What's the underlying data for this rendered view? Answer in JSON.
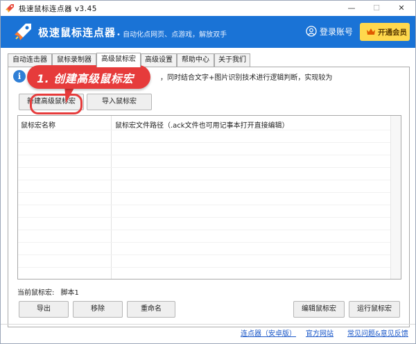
{
  "window": {
    "title": "极速鼠标连点器 v3.45",
    "controls": {
      "minimize": "—",
      "maximize": "☐",
      "close": "✕"
    }
  },
  "header": {
    "brand": "极速鼠标连点器",
    "tagline": "• 自动化点网页、点游戏，解放双手",
    "login_label": "登录账号",
    "vip_label": "开通会员"
  },
  "tabs": [
    {
      "label": "自动连击器"
    },
    {
      "label": "鼠标录制器"
    },
    {
      "label": "高级鼠标宏"
    },
    {
      "label": "高级设置"
    },
    {
      "label": "帮助中心"
    },
    {
      "label": "关于我们"
    }
  ],
  "active_tab": "高级鼠标宏",
  "info": {
    "icon": "i",
    "text": "，同时结合文字+图片识别技术进行逻辑判断，实现较为"
  },
  "buttons": {
    "new_macro": "新建高级鼠标宏",
    "import_macro": "导入鼠标宏",
    "export": "导出",
    "remove": "移除",
    "rename": "重命名",
    "edit_macro": "编辑鼠标宏",
    "run_macro": "运行鼠标宏"
  },
  "table": {
    "columns": [
      "鼠标宏名称",
      "鼠标宏文件路径（.ack文件也可用记事本打开直接编辑）"
    ],
    "rows": []
  },
  "current_macro": {
    "label": "当前鼠标宏:",
    "value": "脚本1"
  },
  "footer_links": [
    "连点器（安卓版）",
    "官方网站",
    "常见问题&意见反馈"
  ],
  "annotation": {
    "text": "1. 创建高级鼠标宏"
  },
  "colors": {
    "header_blue": "#1a73d6",
    "vip_yellow": "#ffd84d",
    "annotation_red": "#e63b3b",
    "link_blue": "#1a57c8"
  }
}
